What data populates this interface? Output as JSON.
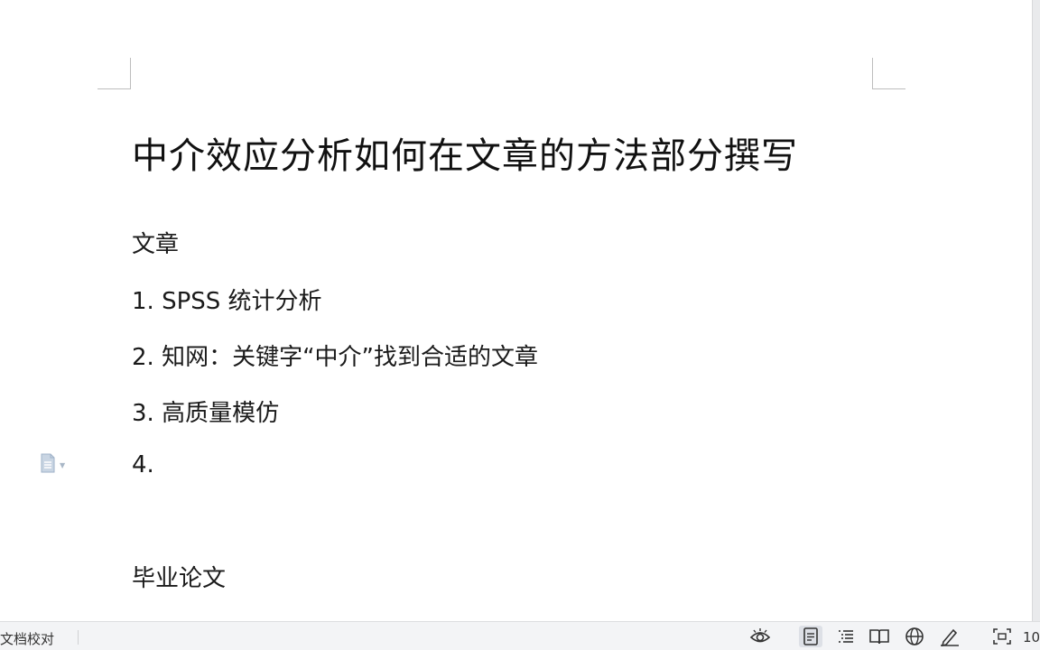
{
  "document": {
    "title": "中介效应分析如何在文章的方法部分撰写",
    "paragraphs": [
      "文章",
      "1. SPSS 统计分析",
      "2. 知网：关键字“中介”找到合适的文章",
      "3. 高质量模仿",
      "4.",
      "毕业论文"
    ]
  },
  "status_bar": {
    "proofread_label": "文档校对",
    "zoom_text": "10",
    "icons": [
      "eye-protection-icon",
      "page-view-icon",
      "outline-view-icon",
      "reading-view-icon",
      "web-view-icon",
      "write-view-icon",
      "fullscreen-icon"
    ]
  },
  "colors": {
    "status_bg": "#f3f4f6",
    "active_icon_bg": "#dde0e6",
    "text": "#1a1a1a"
  }
}
